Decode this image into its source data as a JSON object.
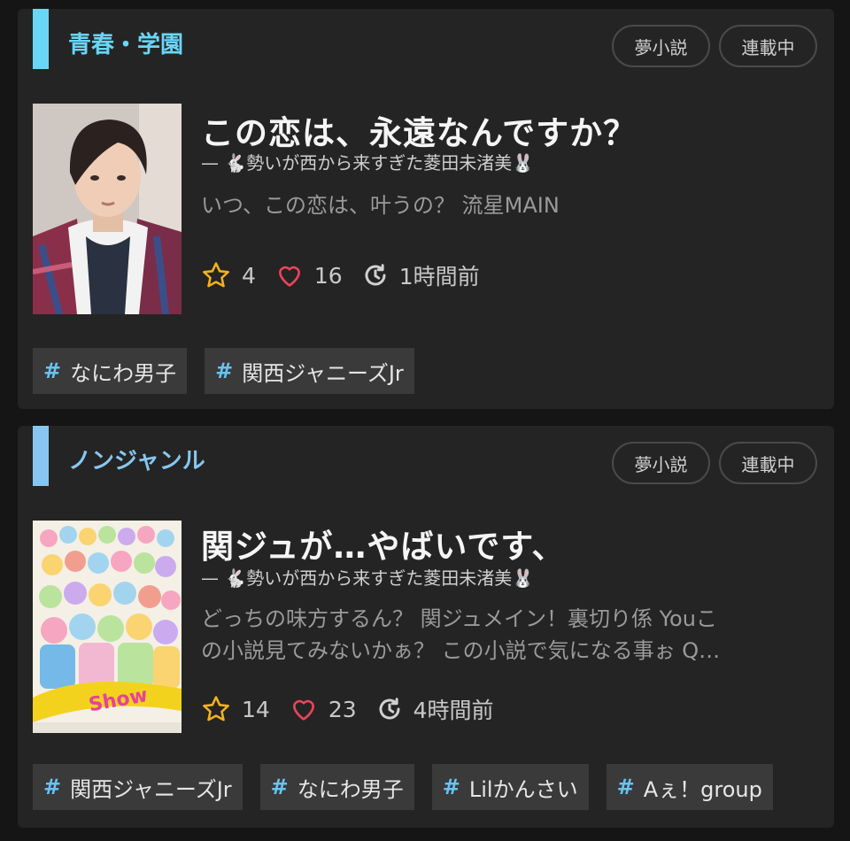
{
  "colors": {
    "accent_card1": "#6ad6f7",
    "accent_card2": "#87c6f0",
    "star": "#f2b21c",
    "heart": "#e8455b",
    "hash": "#69c3f0"
  },
  "stories": [
    {
      "genre": "青春・学園",
      "badges": [
        "夢小説",
        "連載中"
      ],
      "title": "この恋は、永遠なんですか？",
      "author_prefix": "—",
      "author": "🐇勢いが西から来すぎた菱田未渚美🐰",
      "description_lines": [
        "いつ、この恋は、叶うの？ 流星MAIN"
      ],
      "stars": "4",
      "hearts": "16",
      "updated": "1時間前",
      "tags": [
        "なにわ男子",
        "関西ジャニーズJr"
      ]
    },
    {
      "genre": "ノンジャンル",
      "badges": [
        "夢小説",
        "連載中"
      ],
      "title": "関ジュが…やばいです、",
      "author_prefix": "—",
      "author": "🐇勢いが西から来すぎた菱田未渚美🐰",
      "description_lines": [
        "どっちの味方するん？ 関ジュメイン！裏切り係 Youこ",
        "の小説見てみないかぁ？ この小説で気になる事ぉ Q…"
      ],
      "stars": "14",
      "hearts": "23",
      "updated": "4時間前",
      "tags": [
        "関西ジャニーズJr",
        "なにわ男子",
        "Lilかんさい",
        "Aぇ！group"
      ]
    }
  ],
  "icons": {
    "star": "star-icon",
    "heart": "heart-icon",
    "clock": "history-icon",
    "hash": "#"
  }
}
